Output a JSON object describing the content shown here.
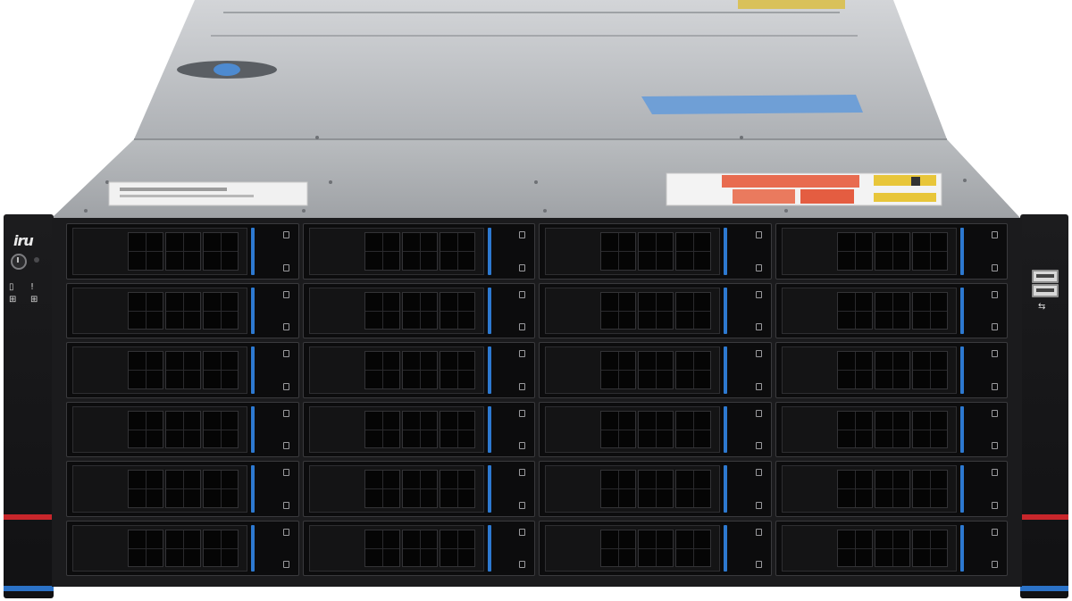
{
  "product": {
    "brand_logo_text": "iru",
    "bay_grid": {
      "columns": 4,
      "rows": 6,
      "total_bays": 24
    },
    "usb_ports": 2,
    "colors": {
      "chassis_lid": "#bcbfc3",
      "front_panel": "#1b1b1d",
      "drive_latch_blue": "#2d79d0",
      "accent_red": "#c8262b",
      "top_blue_sticker": "#6f9fd6"
    },
    "icons": [
      "power-icon",
      "hdd-status-icon",
      "alert-icon",
      "network-icon",
      "usb-icon"
    ]
  }
}
